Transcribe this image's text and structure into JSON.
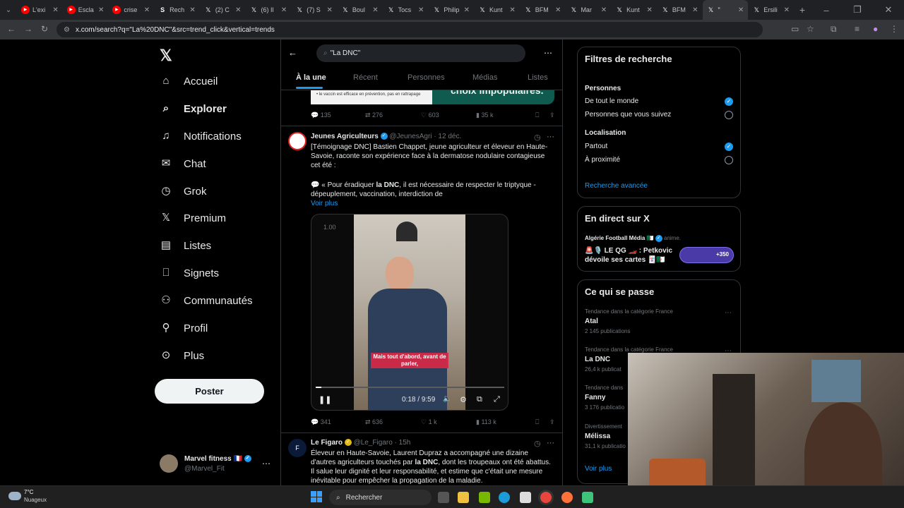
{
  "browser": {
    "tabs": [
      {
        "label": "L'exi",
        "icon": "youtube-icon",
        "color": "#ff0000"
      },
      {
        "label": "Escla",
        "icon": "youtube-icon",
        "color": "#ff0000"
      },
      {
        "label": "crise",
        "icon": "youtube-icon",
        "color": "#ff0000"
      },
      {
        "label": "Rech",
        "icon": "s-icon",
        "color": "#ffffff"
      },
      {
        "label": "(2) C",
        "icon": "x-icon",
        "color": "#ffffff"
      },
      {
        "label": "(6) Il",
        "icon": "x-icon",
        "color": "#ffffff"
      },
      {
        "label": "(7) S",
        "icon": "x-icon",
        "color": "#ffffff"
      },
      {
        "label": "Boul",
        "icon": "x-icon",
        "color": "#ffffff"
      },
      {
        "label": "Tocs",
        "icon": "x-icon",
        "color": "#ffffff"
      },
      {
        "label": "Philip",
        "icon": "x-icon",
        "color": "#ffffff"
      },
      {
        "label": "Kunt",
        "icon": "x-icon",
        "color": "#ffffff"
      },
      {
        "label": "BFM",
        "icon": "x-icon",
        "color": "#ffffff"
      },
      {
        "label": "Mar",
        "icon": "x-icon",
        "color": "#ffffff"
      },
      {
        "label": "Kunt",
        "icon": "x-icon",
        "color": "#ffffff"
      },
      {
        "label": "BFM",
        "icon": "x-icon",
        "color": "#ffffff"
      },
      {
        "label": "\"",
        "icon": "x-icon",
        "color": "#ffffff"
      },
      {
        "label": "Ersili",
        "icon": "x-icon",
        "color": "#ffffff"
      }
    ],
    "url": "x.com/search?q=\"La%20DNC\"&src=trend_click&vertical=trends"
  },
  "nav": {
    "items": [
      {
        "label": "Accueil",
        "icon": "home-icon",
        "glyph": "⌂"
      },
      {
        "label": "Explorer",
        "icon": "search-icon",
        "glyph": "⌕"
      },
      {
        "label": "Notifications",
        "icon": "bell-icon",
        "glyph": "♫"
      },
      {
        "label": "Chat",
        "icon": "mail-icon",
        "glyph": "✉"
      },
      {
        "label": "Grok",
        "icon": "grok-icon",
        "glyph": "◷"
      },
      {
        "label": "Premium",
        "icon": "x-logo-icon",
        "glyph": "𝕏"
      },
      {
        "label": "Listes",
        "icon": "list-icon",
        "glyph": "▤"
      },
      {
        "label": "Signets",
        "icon": "bookmark-icon",
        "glyph": "⎕"
      },
      {
        "label": "Communautés",
        "icon": "people-icon",
        "glyph": "⚇"
      },
      {
        "label": "Profil",
        "icon": "person-icon",
        "glyph": "⚲"
      },
      {
        "label": "Plus",
        "icon": "more-icon",
        "glyph": "⊙"
      }
    ],
    "post_button": "Poster",
    "account": {
      "name": "Marvel fitness 🇫🇷",
      "handle": "@Marvel_Fit"
    }
  },
  "search": {
    "query": "\"La DNC\"",
    "tabs": [
      "À la une",
      "Récent",
      "Personnes",
      "Médias",
      "Listes"
    ]
  },
  "tweets": {
    "top_stats": {
      "replies": "135",
      "retweets": "276",
      "likes": "603",
      "views": "35 k"
    },
    "top_image_text": "• le vaccin est efficace en prévention, pas en rattrapage",
    "top_image_banner": "choix impopulaires.",
    "t1": {
      "name": "Jeunes Agriculteurs",
      "handle": "@JeunesAgri",
      "date": "· 12 déc.",
      "text": "[Témoignage DNC] Bastien Chappet, jeune agriculteur et éleveur en Haute-Savoie, raconte son expérience face à la dermatose nodulaire contagieuse cet été :",
      "quote_pre": "💬 « Pour éradiquer ",
      "quote_bold": "la DNC",
      "quote_post": ", il est nécessaire de respecter le triptyque - dépeuplement, vaccination, interdiction de",
      "more": "Voir plus",
      "video": {
        "speed": "1.00",
        "caption": "Mais tout d'abord, avant de parler,",
        "time": "0:18 / 9:59",
        "progress": 0.03
      },
      "stats": {
        "replies": "341",
        "retweets": "636",
        "likes": "1 k",
        "views": "113 k"
      }
    },
    "t2": {
      "name": "Le Figaro",
      "handle": "@Le_Figaro",
      "date": "· 15h",
      "text_pre": "Éleveur en Haute-Savoie, Laurent Dupraz a accompagné une dizaine d'autres agriculteurs touchés par ",
      "text_bold": "la DNC",
      "text_post": ", dont les troupeaux ont été abattus. Il salue leur dignité et leur responsabilité, et estime que c'était une mesure inévitable pour empêcher la propagation de la maladie."
    }
  },
  "filters": {
    "title": "Filtres de recherche",
    "people_title": "Personnes",
    "people_opts": [
      "De tout le monde",
      "Personnes que vous suivez"
    ],
    "loc_title": "Localisation",
    "loc_opts": [
      "Partout",
      "À proximité"
    ],
    "advanced": "Recherche avancée"
  },
  "live": {
    "title": "En direct sur X",
    "host": "Algérie Football Média 🇩🇿",
    "hosting": "anime.",
    "topic": "🚨🎙️ LE QG 🏎️ : Petkovic dévoile ses cartes 🃏🇩🇿",
    "listeners": "+350"
  },
  "trends": {
    "title": "Ce qui se passe",
    "items": [
      {
        "context": "Tendance dans la catégorie France",
        "name": "Atal",
        "count": "2 145 publications"
      },
      {
        "context": "Tendance dans la catégorie France",
        "name": "La DNC",
        "count": "26,4 k publicat"
      },
      {
        "context": "Tendance dans",
        "name": "Fanny",
        "count": "3 176 publicatio"
      },
      {
        "context": "Divertissement",
        "name": "Mélissa",
        "count": "31,1 k publicatio"
      }
    ],
    "more": "Voir plus"
  },
  "taskbar": {
    "weather_temp": "7°C",
    "weather_desc": "Nuageux",
    "search_placeholder": "Rechercher"
  },
  "colors": {
    "accent": "#1d9bf0",
    "bg": "#000000",
    "border": "#2f3336",
    "muted": "#71767b"
  }
}
